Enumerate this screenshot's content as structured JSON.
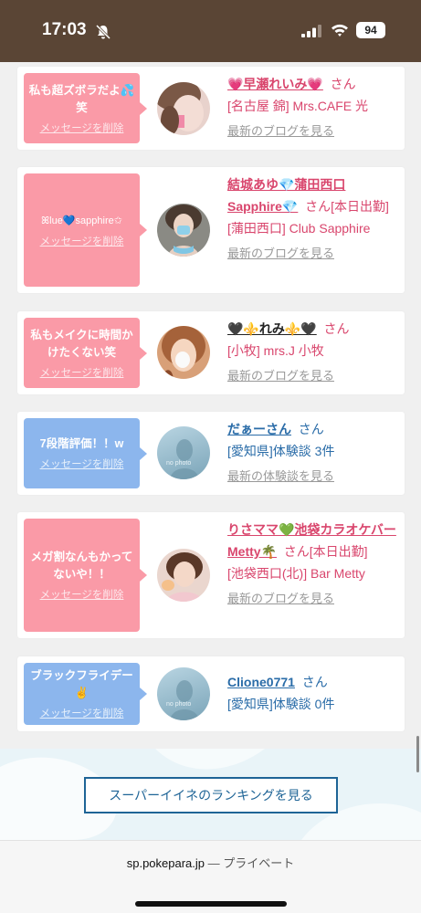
{
  "status_bar": {
    "time": "17:03",
    "battery": "94",
    "icons": [
      "bell-off-icon",
      "signal-icon",
      "wifi-icon",
      "battery-icon"
    ]
  },
  "colors": {
    "status_bg": "#5a4535",
    "bubble_pink": "#fa9aa7",
    "bubble_blue": "#8cb6ed",
    "name_pink": "#d9466d",
    "name_blue": "#2a6ca8",
    "button_border": "#1e6496"
  },
  "cards": [
    {
      "message": "私も超ズボラだよ💦笑",
      "delete_label": "メッセージを削除",
      "name": "💗早瀬れいみ💗",
      "san": "さん",
      "shop": "[名古屋 錦] Mrs.CAFE 光",
      "link": "最新のブログを見る"
    },
    {
      "message": "ꕤlue💙sapphire✩",
      "delete_label": "メッセージを削除",
      "name": "結城あゆ💎蒲田西口Sapphire💎",
      "san": "さん[本日出勤]",
      "shop": "[蒲田西口] Club Sapphire",
      "link": "最新のブログを見る"
    },
    {
      "message": "私もメイクに時間かけたくない笑",
      "delete_label": "メッセージを削除",
      "name": "🖤⚜️れみ⚜️🖤",
      "san": "さん",
      "shop": "[小牧] mrs.J 小牧",
      "link": "最新のブログを見る"
    },
    {
      "message": "7段階評価！！w",
      "delete_label": "メッセージを削除",
      "name": "だぁーさん",
      "san": "さん",
      "shop": "[愛知県]体験談 3件",
      "link": "最新の体験談を見る",
      "avatar_text": "no photo"
    },
    {
      "message": "メガ割なんもかってないや！！",
      "delete_label": "メッセージを削除",
      "name": "りさママ💚池袋カラオケバーMetty🌴",
      "san": "さん[本日出勤]",
      "shop": "[池袋西口(北)] Bar Metty",
      "link": "最新のブログを見る"
    },
    {
      "message": "ブラックフライデー✌️",
      "delete_label": "メッセージを削除",
      "name": "Clione0771",
      "san": "さん",
      "shop": "[愛知県]体験談 0件",
      "avatar_text": "no photo"
    }
  ],
  "ranking_button": "スーパーイイネのランキングを見る",
  "url_bar": {
    "domain": "sp.pokepara.jp",
    "suffix": "— プライベート"
  }
}
